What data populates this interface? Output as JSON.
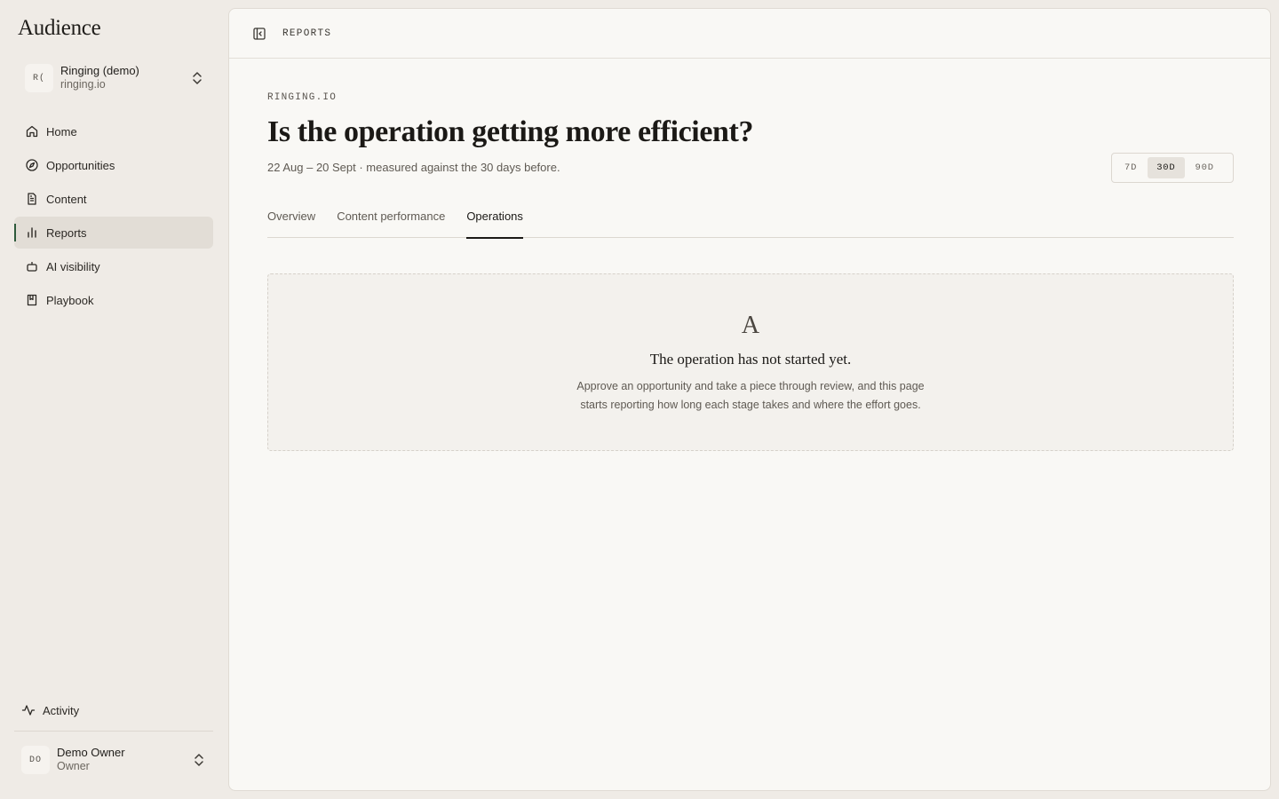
{
  "sidebar": {
    "brand": "Audience",
    "workspace": {
      "initials": "R(",
      "name": "Ringing (demo)",
      "domain": "ringing.io"
    },
    "items": [
      {
        "label": "Home",
        "icon": "home-icon",
        "active": false
      },
      {
        "label": "Opportunities",
        "icon": "compass-icon",
        "active": false
      },
      {
        "label": "Content",
        "icon": "document-icon",
        "active": false
      },
      {
        "label": "Reports",
        "icon": "bar-chart-icon",
        "active": true
      },
      {
        "label": "AI visibility",
        "icon": "robot-icon",
        "active": false
      },
      {
        "label": "Playbook",
        "icon": "book-icon",
        "active": false
      }
    ],
    "activity": "Activity",
    "user": {
      "initials": "DO",
      "name": "Demo Owner",
      "role": "Owner"
    }
  },
  "topbar": {
    "title": "REPORTS"
  },
  "page": {
    "eyebrow": "RINGING.IO",
    "title": "Is the operation getting more efficient?",
    "subtitle": "22 Aug – 20 Sept · measured against the 30 days before.",
    "range": {
      "options": [
        "7D",
        "30D",
        "90D"
      ],
      "selected": "30D"
    },
    "tabs": [
      {
        "label": "Overview",
        "active": false
      },
      {
        "label": "Content performance",
        "active": false
      },
      {
        "label": "Operations",
        "active": true
      }
    ]
  },
  "empty_state": {
    "glyph": "A",
    "title": "The operation has not started yet.",
    "body_line1": "Approve an opportunity and take a piece through review, and this page",
    "body_line2": "starts reporting how long each stage takes and where the effort goes."
  },
  "colors": {
    "accent": "#2e5a3c",
    "background": "#efebe6",
    "panel": "#f9f8f5"
  }
}
